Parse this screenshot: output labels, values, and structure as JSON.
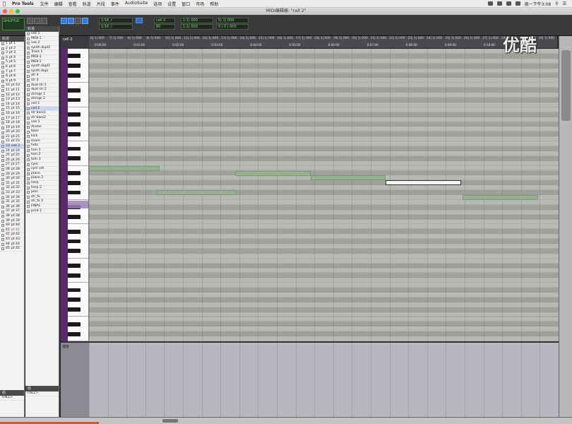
{
  "menubar": {
    "app": "Pro Tools",
    "items": [
      "文件",
      "编辑",
      "查看",
      "轨道",
      "片段",
      "事件",
      "AudioSuite",
      "选项",
      "设置",
      "窗口",
      "市场",
      "帮助"
    ],
    "clock": "周一下午3:08"
  },
  "window": {
    "title": "MIDI编辑器: \"cell 2\""
  },
  "toolbar": {
    "counter": "1:1| 000",
    "grid": "1/16 ♪",
    "nudge": "1/16 ♪",
    "track_field": "cell 2",
    "start": "1:1| 000",
    "end": "5| 1| 000",
    "length": "0 | 0 | 000",
    "velocity": "80",
    "mode": "SHUFFLE"
  },
  "tracks_panel": {
    "header": "轨道",
    "rows": [
      {
        "num": "1",
        "name": "pt 1"
      },
      {
        "num": "2",
        "name": "pt 2"
      },
      {
        "num": "3",
        "name": "pt 3"
      },
      {
        "num": "4",
        "name": "pt 4"
      },
      {
        "num": "5",
        "name": "pt 5"
      },
      {
        "num": "6",
        "name": "pt 6"
      },
      {
        "num": "7",
        "name": "pt 7"
      },
      {
        "num": "8",
        "name": "pt 8"
      },
      {
        "num": "9",
        "name": "pt 9"
      },
      {
        "num": "10",
        "name": "pt 10"
      },
      {
        "num": "11",
        "name": "pt 11"
      },
      {
        "num": "12",
        "name": "pt 12"
      },
      {
        "num": "13",
        "name": "pt 13"
      },
      {
        "num": "14",
        "name": "pt 14"
      },
      {
        "num": "15",
        "name": "pt 15"
      },
      {
        "num": "16",
        "name": "pt 16"
      },
      {
        "num": "17",
        "name": "pt 17"
      },
      {
        "num": "18",
        "name": "pt 18"
      },
      {
        "num": "19",
        "name": "pt 19"
      },
      {
        "num": "20",
        "name": "pt 20"
      },
      {
        "num": "21",
        "name": "pt 21"
      },
      {
        "num": "22",
        "name": "pt 22"
      },
      {
        "num": "23",
        "name": "cell 2"
      },
      {
        "num": "24",
        "name": "pt 24"
      },
      {
        "num": "25",
        "name": "pt 25"
      },
      {
        "num": "26",
        "name": "pt 26"
      },
      {
        "num": "27",
        "name": "pt 27"
      },
      {
        "num": "28",
        "name": "pt 28"
      },
      {
        "num": "29",
        "name": "pt 29"
      },
      {
        "num": "30",
        "name": "pt 30"
      },
      {
        "num": "31",
        "name": "pt 31"
      },
      {
        "num": "32",
        "name": "pt 32"
      },
      {
        "num": "33",
        "name": "pt 33"
      },
      {
        "num": "34",
        "name": "pt 34"
      },
      {
        "num": "35",
        "name": "pt 35"
      },
      {
        "num": "36",
        "name": "pt 36"
      },
      {
        "num": "37",
        "name": "pt 37"
      },
      {
        "num": "38",
        "name": "pt 38"
      },
      {
        "num": "39",
        "name": "pt 39"
      },
      {
        "num": "40",
        "name": "pt 40"
      },
      {
        "num": "41",
        "name": "pt 41"
      },
      {
        "num": "42",
        "name": "pt 42"
      },
      {
        "num": "43",
        "name": "pt 43"
      },
      {
        "num": "44",
        "name": "pt 44"
      },
      {
        "num": "45",
        "name": "pt 45"
      }
    ],
    "footer_header": "组",
    "footer_rows": [
      "<ALL>"
    ]
  },
  "clips_panel": {
    "header": "轨道",
    "rows": [
      "vox 1",
      "MIDI 1",
      "vox 2",
      "synth dupl2",
      "Track 1",
      "MIDI 1",
      "MIDI 1",
      "synth dupl1",
      "synth dupl",
      "str 4",
      "str 3",
      "dual str 1",
      "dual str 2",
      "strings 1",
      "strings 2",
      "cell 1",
      "cell 2",
      "str bass1",
      "str bass2",
      "vox 1",
      "drums",
      "bass",
      "kick",
      "snare",
      "hats",
      "tom 1",
      "tom 2",
      "tom 3",
      "cym",
      "cym set",
      "piano",
      "piano 2",
      "harp",
      "harp 2",
      "perc",
      "str_fx",
      "str_fx 2",
      "FINAL",
      "print 1"
    ],
    "footer_header": "组",
    "footer_rows": [
      "<ALL>"
    ]
  },
  "editor": {
    "track_label": "cell 2",
    "ruler_bars": [
      "6| 1| 000",
      "7| 1| 000",
      "8| 1| 000",
      "9| 1| 000",
      "10| 1| 000",
      "11| 1| 000",
      "12| 1| 000",
      "13| 1| 000",
      "14| 1| 000",
      "15| 1| 000",
      "16| 1| 000",
      "17| 1| 000",
      "18| 1| 000",
      "19| 1| 000",
      "20| 1| 000",
      "21| 1| 000",
      "22| 1| 000",
      "23| 1| 000",
      "24| 1| 000",
      "25| 1| 000",
      "26| 1| 000",
      "27| 1| 000",
      "28| 1| 000",
      "29| 1| 000",
      "30| 1| 000"
    ],
    "ruler_times": [
      "0:00:00",
      "0:01:00",
      "0:02:00",
      "0:03:00",
      "0:04:00",
      "0:05:00",
      "0:06:00",
      "0:07:00",
      "0:08:00",
      "0:09:00",
      "0:10:00",
      "0:11:00"
    ],
    "notes": [
      {
        "pitch": "A3",
        "start_bar": 6.0,
        "length_bars": 3.75,
        "selected": false
      },
      {
        "pitch": "E3",
        "start_bar": 9.6,
        "length_bars": 4.25,
        "selected": false
      },
      {
        "pitch": "G#3",
        "start_bar": 13.8,
        "length_bars": 4.0,
        "selected": false
      },
      {
        "pitch": "G3",
        "start_bar": 17.8,
        "length_bars": 4.0,
        "selected": false
      },
      {
        "pitch": "F#3",
        "start_bar": 21.8,
        "length_bars": 4.0,
        "selected": true
      },
      {
        "pitch": "D#3",
        "start_bar": 25.9,
        "length_bars": 4.0,
        "selected": false
      }
    ],
    "velocity_label": "速度"
  },
  "watermark": "优酷",
  "colors": {
    "grid_light": "#b7b9b3",
    "grid_dark": "#9fa19b",
    "note": "#97b08f",
    "note_selected": "#f4f4f4",
    "accent": "#2d6fd1",
    "track_strip": "#5b2a6e"
  }
}
